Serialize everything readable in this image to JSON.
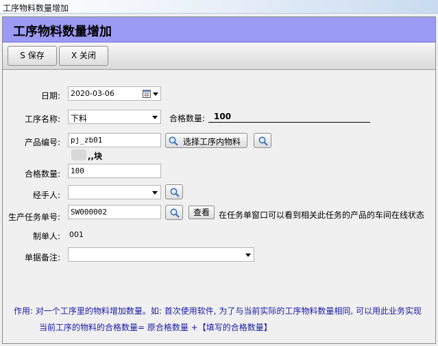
{
  "window": {
    "title": "工序物料数量增加"
  },
  "header": {
    "title": "工序物料数量增加"
  },
  "toolbar": {
    "save_label": "S 保存",
    "close_label": "X 关闭"
  },
  "form": {
    "date_label": "日期:",
    "date_value": "2020-03-06",
    "process_label": "工序名称:",
    "process_value": "下料",
    "qualified_qty_caption": "合格数量:",
    "qualified_qty_current": "100",
    "product_label": "产品编号:",
    "product_value": "pj_zb01",
    "select_material_label": "选择工序内物料",
    "product_unit": ",,块",
    "qty_label": "合格数量:",
    "qty_value": "100",
    "handler_label": "经手人:",
    "handler_value": "",
    "task_label": "生产任务单号:",
    "task_value": "SW000002",
    "view_label": "查看",
    "task_hint": "在任务单窗口可以看到相关此任务的产品的车间在线状态",
    "maker_label": "制单人:",
    "maker_value": "001",
    "remark_label": "单据备注:",
    "remark_value": ""
  },
  "help": {
    "line1": "作用: 对一个工序里的物料增加数量。如: 首次使用软件, 为了与当前实际的工序物料数量相同, 可以用此业务实现",
    "line2": "当前工序的物料的合格数量= 原合格数量 +【填写的合格数量】"
  },
  "colors": {
    "header_bg": "#9b9bf5",
    "help_text": "#1a1aa6"
  }
}
